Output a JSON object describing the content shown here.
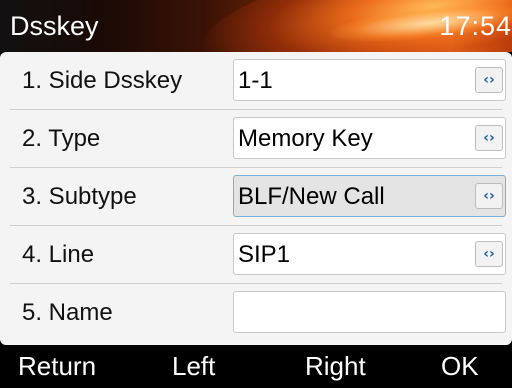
{
  "header": {
    "title": "Dsskey",
    "time": "17:54"
  },
  "form": {
    "rows": [
      {
        "label": "1.  Side Dsskey",
        "value": "1-1",
        "has_arrows": true
      },
      {
        "label": "2.  Type",
        "value": "Memory Key",
        "has_arrows": true
      },
      {
        "label": "3.  Subtype",
        "value": "BLF/New Call",
        "has_arrows": true,
        "focused": true
      },
      {
        "label": "4.  Line",
        "value": "SIP1",
        "has_arrows": true
      },
      {
        "label": "5.  Name",
        "value": "",
        "has_arrows": false
      }
    ],
    "arrow_glyph": "‹›"
  },
  "softkeys": {
    "return_label": "Return",
    "left_label": "Left",
    "right_label": "Right",
    "ok_label": "OK"
  },
  "colors": {
    "accent_orange": "#e8701e",
    "arrow_blue": "#1c5fa8",
    "focus_border": "#7aaedb"
  }
}
